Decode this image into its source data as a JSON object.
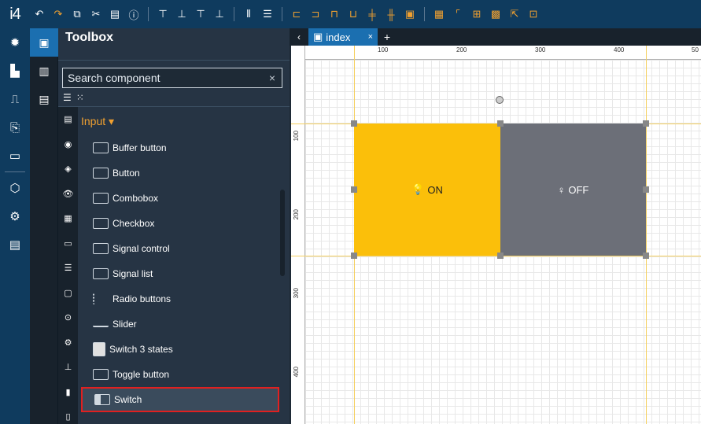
{
  "app": {
    "logo": "i4"
  },
  "toolbar": {
    "icons": [
      "undo-icon",
      "redo-icon",
      "copy-icon",
      "cut-icon",
      "paste-icon",
      "info-icon",
      "align-top-icon",
      "align-bottom-icon",
      "align-top-2-icon",
      "align-bottom-2-icon",
      "distribute-h-icon",
      "distribute-v-icon",
      "align-left-icon",
      "align-right-icon",
      "align-top-3-icon",
      "align-bottom-3-icon",
      "center-h-icon",
      "center-v-icon",
      "group-icon",
      "grid-icon",
      "snap-icon",
      "grid-toggle-icon",
      "pointer-icon",
      "fit-icon"
    ]
  },
  "toolbox": {
    "title": "Toolbox",
    "search_placeholder": "Search component",
    "clear_symbol": "×",
    "group": "Input ▾",
    "items": [
      {
        "label": "Buffer button"
      },
      {
        "label": "Button"
      },
      {
        "label": "Combobox"
      },
      {
        "label": "Checkbox"
      },
      {
        "label": "Signal control"
      },
      {
        "label": "Signal list"
      },
      {
        "label": "Radio buttons"
      },
      {
        "label": "Slider"
      },
      {
        "label": "Switch 3 states"
      },
      {
        "label": "Toggle button"
      },
      {
        "label": "Switch"
      }
    ]
  },
  "tabs": [
    {
      "label": "index",
      "close": "×"
    }
  ],
  "tab_nav": {
    "back": "‹",
    "add": "+"
  },
  "ruler": {
    "top": [
      "100",
      "200",
      "300",
      "400",
      "50"
    ],
    "left": [
      "100",
      "200",
      "300",
      "400"
    ]
  },
  "canvas": {
    "switch_on_label": "ON",
    "switch_off_label": "OFF",
    "on_color": "#fbbf0a",
    "off_color": "#6c6f78"
  }
}
